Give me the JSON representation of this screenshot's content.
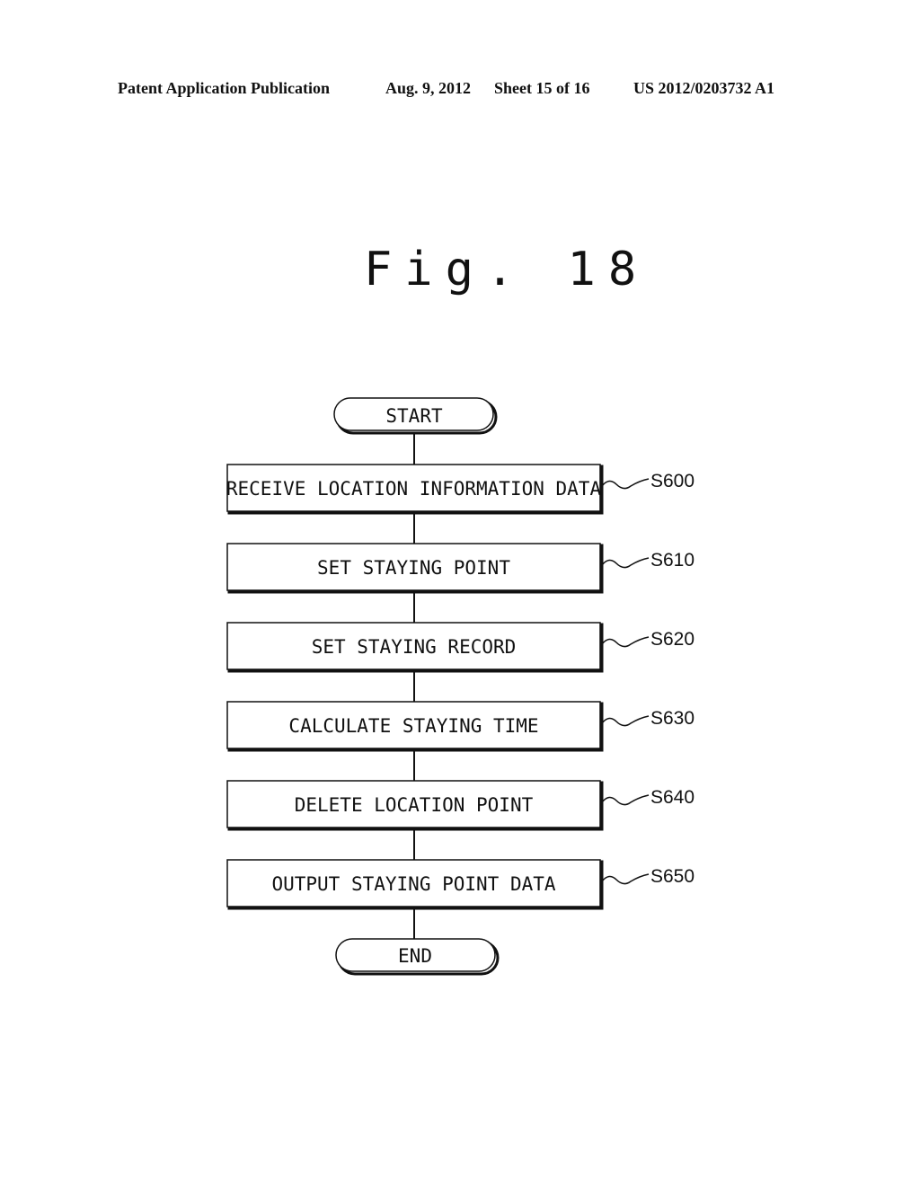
{
  "header": {
    "publication": "Patent Application Publication",
    "date": "Aug. 9, 2012",
    "sheet": "Sheet 15 of 16",
    "number": "US 2012/0203732 A1"
  },
  "figure": {
    "title": "Fig. 18"
  },
  "flowchart": {
    "start": "START",
    "end": "END",
    "steps": [
      {
        "id": "S600",
        "text": "RECEIVE LOCATION INFORMATION DATA"
      },
      {
        "id": "S610",
        "text": "SET STAYING POINT"
      },
      {
        "id": "S620",
        "text": "SET STAYING RECORD"
      },
      {
        "id": "S630",
        "text": "CALCULATE STAYING TIME"
      },
      {
        "id": "S640",
        "text": "DELETE LOCATION POINT"
      },
      {
        "id": "S650",
        "text": "OUTPUT STAYING POINT DATA"
      }
    ]
  }
}
